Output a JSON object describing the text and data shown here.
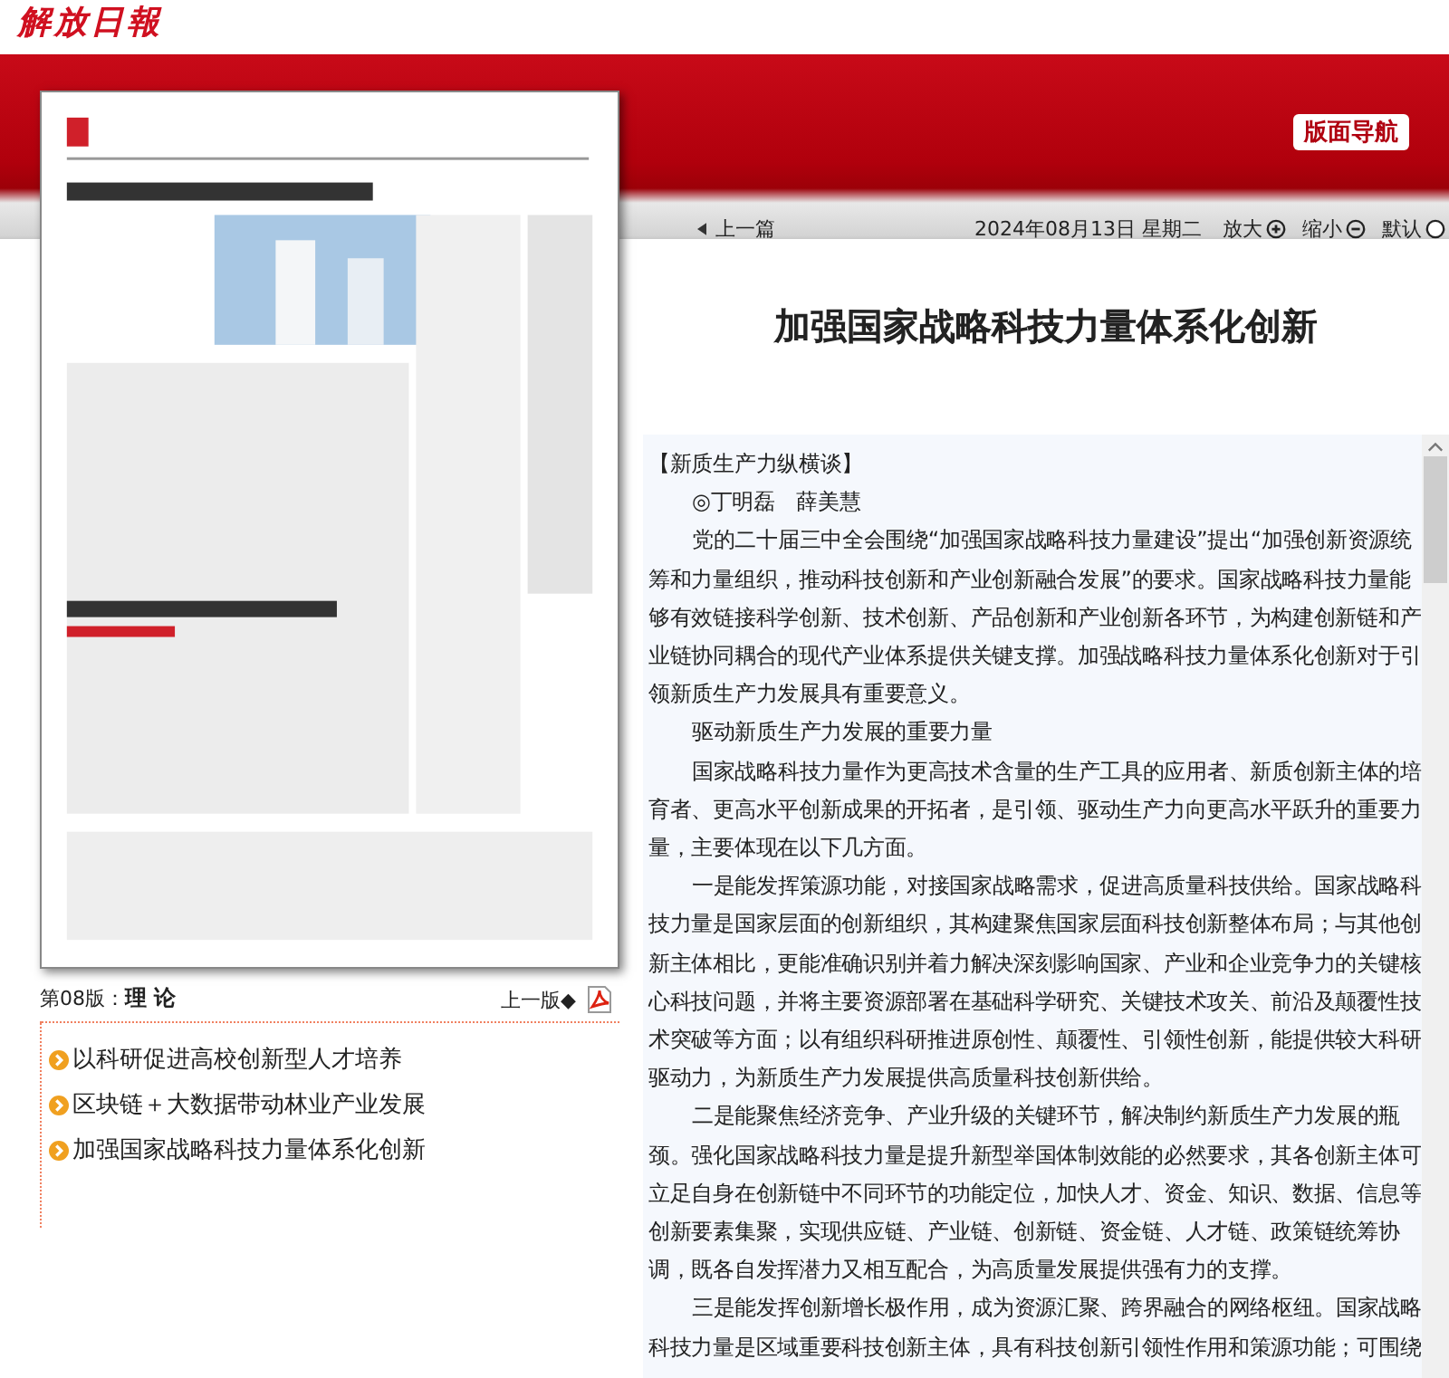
{
  "logo": "解放日報",
  "nav_button": "版面导航",
  "toolbar": {
    "prev": "上一篇",
    "date": "2024年08月13日 星期二",
    "zoom_in": "放大",
    "zoom_out": "缩小",
    "reset": "默认"
  },
  "page_label": {
    "prefix": "第08版：",
    "name": "理 论"
  },
  "prev_page": "上一版◆",
  "articles": [
    {
      "title": "以科研促进高校创新型人才培养"
    },
    {
      "title": "区块链＋大数据带动林业产业发展"
    },
    {
      "title": "加强国家战略科技力量体系化创新"
    }
  ],
  "headline": "加强国家战略科技力量体系化创新",
  "body": [
    {
      "kind": "column",
      "text": "【新质生产力纵横谈】"
    },
    {
      "kind": "byline",
      "text": "◎丁明磊　薛美慧"
    },
    {
      "kind": "para",
      "text": "党的二十届三中全会围绕“加强国家战略科技力量建设”提出“加强创新资源统筹和力量组织，推动科技创新和产业创新融合发展”的要求。国家战略科技力量能够有效链接科学创新、技术创新、产品创新和产业创新各环节，为构建创新链和产业链协同耦合的现代产业体系提供关键支撑。加强战略科技力量体系化创新对于引领新质生产力发展具有重要意义。"
    },
    {
      "kind": "para",
      "text": "驱动新质生产力发展的重要力量"
    },
    {
      "kind": "para",
      "text": "国家战略科技力量作为更高技术含量的生产工具的应用者、新质创新主体的培育者、更高水平创新成果的开拓者，是引领、驱动生产力向更高水平跃升的重要力量，主要体现在以下几方面。"
    },
    {
      "kind": "para",
      "text": "一是能发挥策源功能，对接国家战略需求，促进高质量科技供给。国家战略科技力量是国家层面的创新组织，其构建聚焦国家层面科技创新整体布局；与其他创新主体相比，更能准确识别并着力解决深刻影响国家、产业和企业竞争力的关键核心科技问题，并将主要资源部署在基础科学研究、关键技术攻关、前沿及颠覆性技术突破等方面；以有组织科研推进原创性、颠覆性、引领性创新，能提供较大科研驱动力，为新质生产力发展提供高质量科技创新供给。"
    },
    {
      "kind": "para",
      "text": "二是能聚焦经济竞争、产业升级的关键环节，解决制约新质生产力发展的瓶颈。强化国家战略科技力量是提升新型举国体制效能的必然要求，其各创新主体可立足自身在创新链中不同环节的功能定位，加快人才、资金、知识、数据、信息等创新要素集聚，实现供应链、产业链、创新链、资金链、人才链、政策链统筹协调，既各自发挥潜力又相互配合，为高质量发展提供强有力的支撑。"
    },
    {
      "kind": "para",
      "text": "三是能发挥创新增长极作用，成为资源汇聚、跨界融合的网络枢纽。国家战略科技力量是区域重要科技创新主体，具有科技创新引领性作用和策源功能；可围绕"
    }
  ]
}
